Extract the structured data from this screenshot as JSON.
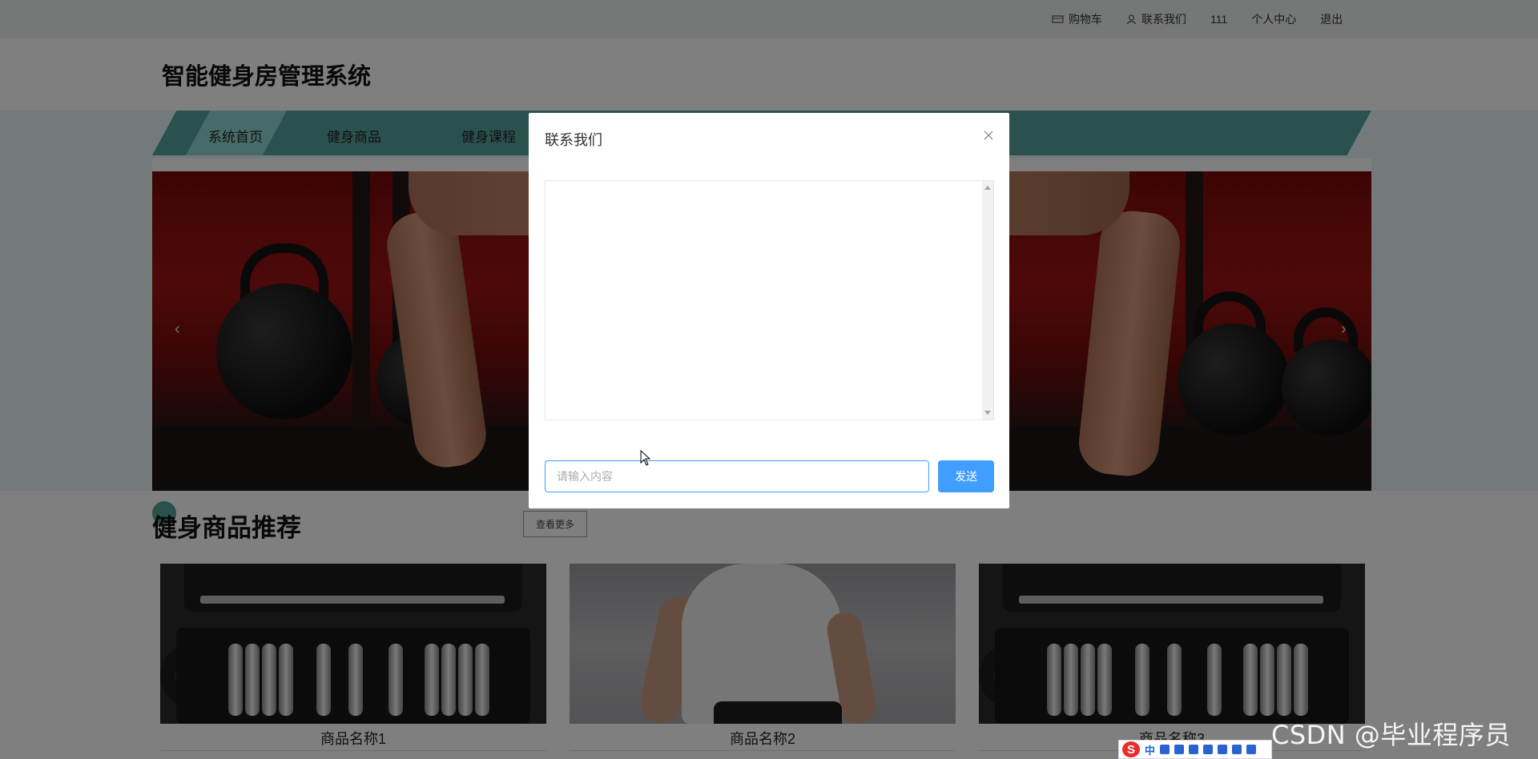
{
  "topbar": {
    "cart": "购物车",
    "contact": "联系我们",
    "username": "111",
    "profile": "个人中心",
    "logout": "退出"
  },
  "header": {
    "title": "智能健身房管理系统"
  },
  "nav": {
    "items": [
      "系统首页",
      "健身商品",
      "健身课程"
    ],
    "active_index": 0
  },
  "banner": {
    "prev": "‹",
    "next": "›"
  },
  "section": {
    "title": "健身商品推荐",
    "more_label": "查看更多"
  },
  "products": [
    {
      "name": "商品名称1",
      "image": "dumbbell-case"
    },
    {
      "name": "商品名称2",
      "image": "runner"
    },
    {
      "name": "商品名称3",
      "image": "dumbbell-case"
    }
  ],
  "modal": {
    "title": "联系我们",
    "input_placeholder": "请输入内容",
    "send_label": "发送"
  },
  "watermark": "CSDN @毕业程序员",
  "ime": {
    "label": "中"
  },
  "colors": {
    "primary": "#409eff",
    "nav": "#55a29c",
    "nav_active": "#8dd6d0",
    "overlay": "rgba(0,0,0,0.5)"
  }
}
